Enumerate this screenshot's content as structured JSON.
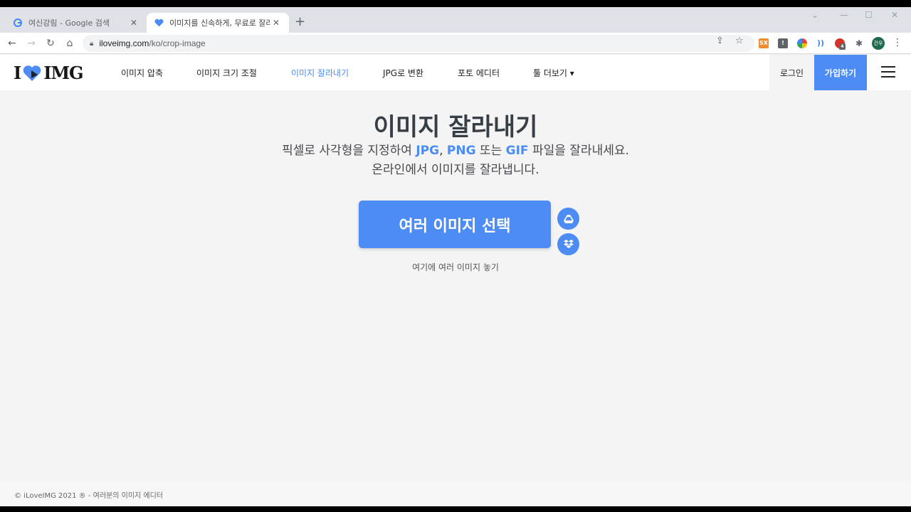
{
  "browser": {
    "tabs": [
      {
        "title": "여신강림 - Google 검색",
        "favicon": "G"
      },
      {
        "title": "이미지를 신속하게, 무료로 잘라",
        "favicon": "heart"
      }
    ],
    "url_host": "iloveimg.com",
    "url_path": "/ko/crop-image",
    "profile_initials": "건우",
    "extension_badge": "4"
  },
  "site": {
    "logo_left": "I",
    "logo_right": "IMG",
    "nav": [
      {
        "label": "이미지 압축"
      },
      {
        "label": "이미지 크기 조절"
      },
      {
        "label": "이미지 잘라내기"
      },
      {
        "label": "JPG로 변환"
      },
      {
        "label": "포토 에디터"
      },
      {
        "label": "툴 더보기 ▾"
      }
    ],
    "login_label": "로그인",
    "signup_label": "가입하기"
  },
  "main": {
    "title": "이미지 잘라내기",
    "subtitle_line1_a": "픽셀로 사각형을 지정하여 ",
    "fmt1": "JPG",
    "sep1": ", ",
    "fmt2": "PNG",
    "sep2": " 또는 ",
    "fmt3": "GIF",
    "subtitle_line1_b": " 파일을 잘라내세요.",
    "subtitle_line2": "온라인에서 이미지를 잘라냅니다.",
    "select_button": "여러 이미지 선택",
    "drop_hint": "여기에 여러 이미지 놓기"
  },
  "footer": {
    "text": "© iLoveIMG 2021 ® - 여러분의 이미지 에디터"
  },
  "colors": {
    "accent": "#4d8cf5",
    "heading": "#383e45"
  }
}
